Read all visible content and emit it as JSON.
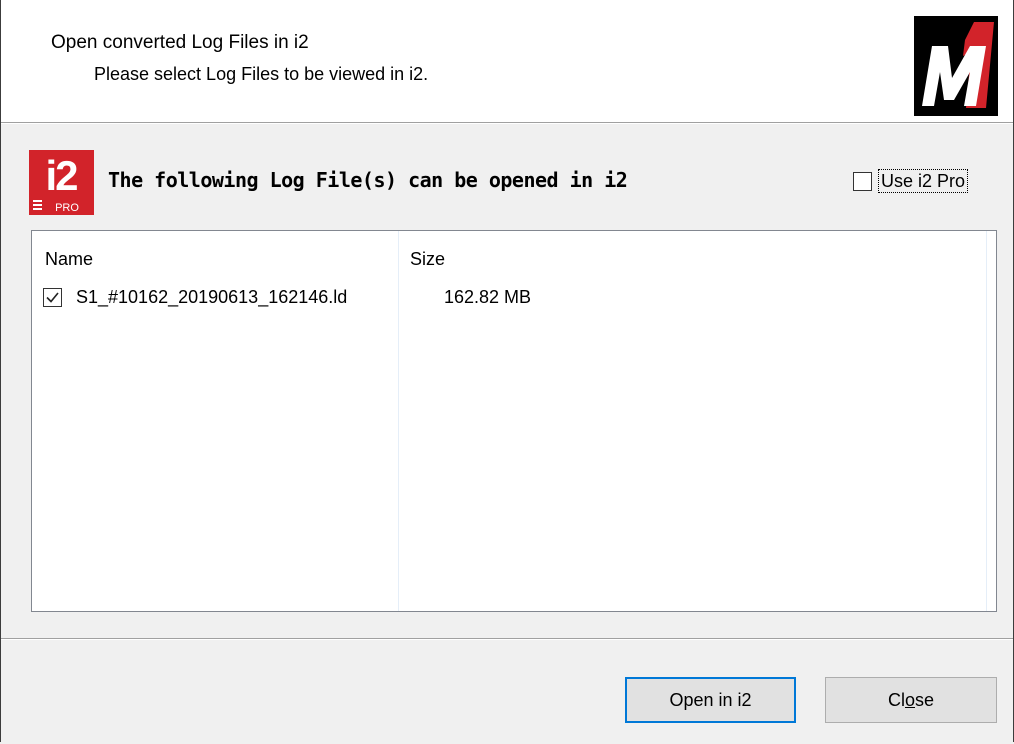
{
  "header": {
    "title": "Open converted Log Files in i2",
    "subtitle": "Please select Log Files to be viewed in i2.",
    "logo_text": "M1"
  },
  "section": {
    "icon": "i2-pro-logo-icon",
    "icon_text": "i2",
    "icon_subtext": "PRO",
    "heading": "The following Log File(s) can be opened in i2",
    "use_pro_label": "Use i2 Pro",
    "use_pro_checked": false
  },
  "list": {
    "columns": [
      "Name",
      "Size"
    ],
    "rows": [
      {
        "name": "S1_#10162_20190613_162146.ld",
        "size": "162.82 MB",
        "checked": true
      }
    ]
  },
  "buttons": {
    "open_label": "Open in i2",
    "close_label_pre": "Cl",
    "close_label_mnemonic": "o",
    "close_label_post": "se"
  },
  "colors": {
    "accent_red": "#d2232a",
    "focus_blue": "#0078d7"
  }
}
